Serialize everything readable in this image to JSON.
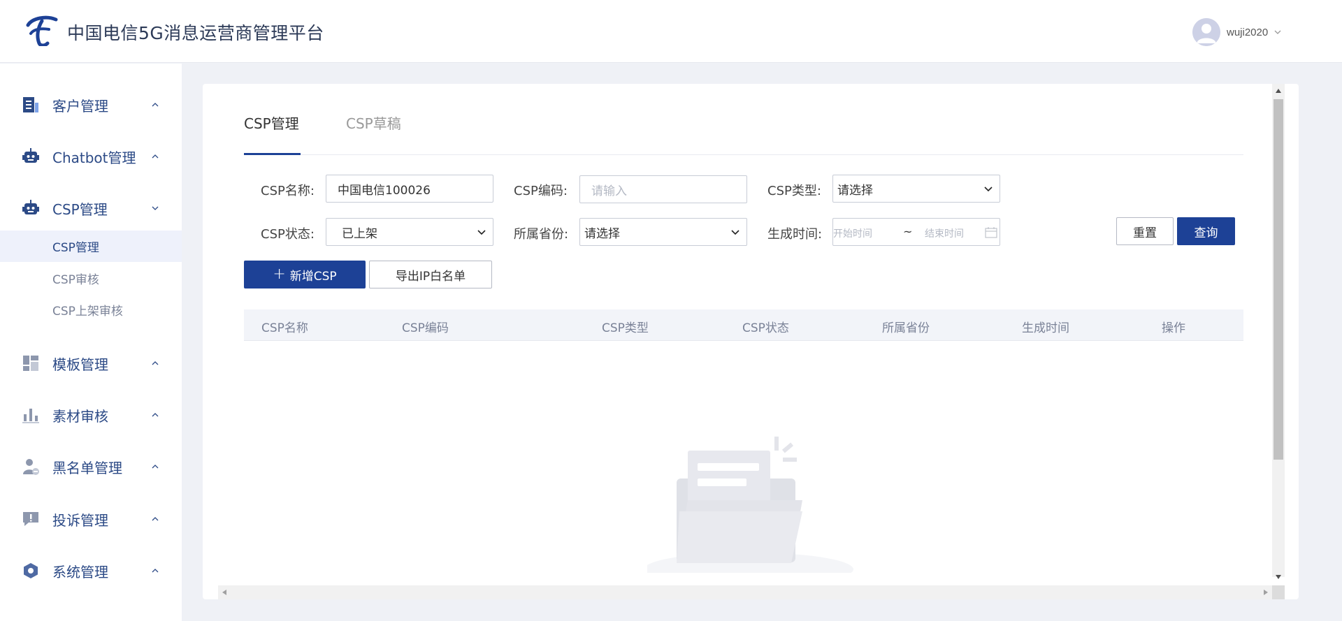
{
  "app": {
    "title": "中国电信5G消息运营商管理平台"
  },
  "user": {
    "name": "wuji2020"
  },
  "sidebar": {
    "groups": [
      {
        "label": "客户管理",
        "icon": "client-doc-icon",
        "expanded": false
      },
      {
        "label": "Chatbot管理",
        "icon": "robot-icon",
        "expanded": false
      },
      {
        "label": "CSP管理",
        "icon": "robot-icon",
        "expanded": true
      },
      {
        "label": "模板管理",
        "icon": "template-grid-icon",
        "expanded": false
      },
      {
        "label": "素材审核",
        "icon": "bar-chart-icon",
        "expanded": false
      },
      {
        "label": "黑名单管理",
        "icon": "user-block-icon",
        "expanded": false
      },
      {
        "label": "投诉管理",
        "icon": "complaint-icon",
        "expanded": false
      },
      {
        "label": "系统管理",
        "icon": "settings-hex-icon",
        "expanded": false
      }
    ],
    "csp_subitems": [
      {
        "label": "CSP管理",
        "active": true
      },
      {
        "label": "CSP审核",
        "active": false
      },
      {
        "label": "CSP上架审核",
        "active": false
      }
    ]
  },
  "tabs": [
    {
      "label": "CSP管理",
      "active": true
    },
    {
      "label": "CSP草稿",
      "active": false
    }
  ],
  "filters": {
    "csp_name": {
      "label": "CSP名称:",
      "value": "中国电信100026"
    },
    "csp_code": {
      "label": "CSP编码:",
      "placeholder": "请输入"
    },
    "csp_type": {
      "label": "CSP类型:",
      "value": "请选择"
    },
    "csp_status": {
      "label": "CSP状态:",
      "value": "已上架"
    },
    "province": {
      "label": "所属省份:",
      "value": "请选择"
    },
    "created_time": {
      "label": "生成时间:",
      "start_placeholder": "开始时间",
      "separator": "~",
      "end_placeholder": "结束时间"
    }
  },
  "buttons": {
    "reset": "重置",
    "query": "查询",
    "add_csp": "新增CSP",
    "export_ip": "导出IP白名单"
  },
  "table": {
    "columns": [
      "CSP名称",
      "CSP编码",
      "CSP类型",
      "CSP状态",
      "所属省份",
      "生成时间",
      "操作"
    ],
    "rows": []
  },
  "colors": {
    "primary": "#1d4196",
    "nav_text": "#2c4a86",
    "sidebar_active_bg": "#eef1fb",
    "page_bg": "#eff1f6"
  }
}
